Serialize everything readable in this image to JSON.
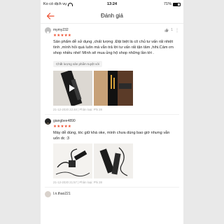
{
  "status_bar": {
    "carrier": "Ko có dịch vụ",
    "time": "13:24",
    "battery": "71%"
  },
  "header": {
    "title": "Đánh giá"
  },
  "reviews": [
    {
      "user": "mymy232",
      "stars": "★★★★★",
      "likes": "1",
      "text": "Sản phẩm dễ sử dụng ,chất lượng .Đặt biệt là cô chủ tư vấn rất nhiệt tình ,mình hỏi quá luôn mà vẫn trả lời tư vấn rất tận tâm ,hihi.Cảm ơn shop nhiều nhé! Mình sẽ mua ủng hộ shop những lần tới .",
      "tag": "Chất lượng sản phẩm tuyệt vời",
      "meta": "21-12-2020 22:48 | Phân loại: Phi 28"
    },
    {
      "user": "giangbee4890",
      "stars": "★★★★★",
      "text": "Máy dễ dùng, tóc giữ khá oke, mình chưa dùng bao giờ nhưng vẫn uốn dc :3",
      "meta": "21-12-2020 21:57 | Phân loại: Phi 28"
    },
    {
      "user": "l.n.thao221"
    }
  ],
  "colors": {
    "accent": "#ee4d2d"
  }
}
